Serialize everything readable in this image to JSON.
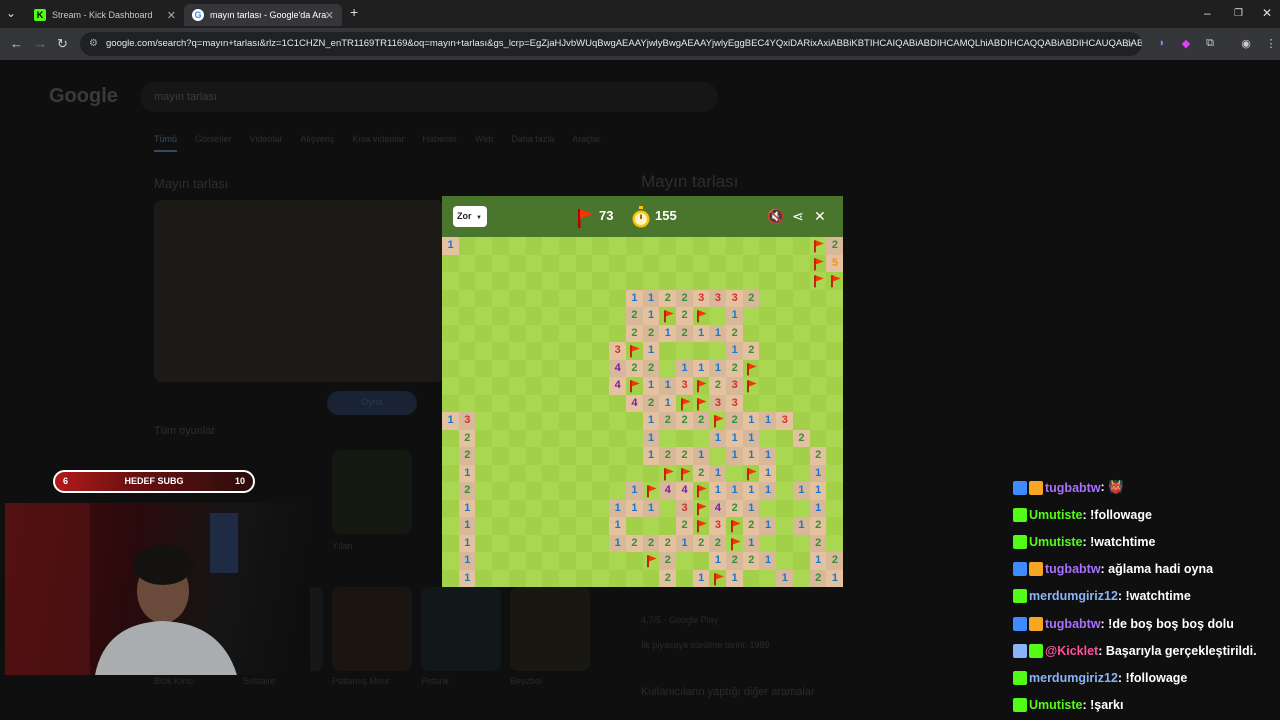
{
  "browser": {
    "tabs": [
      {
        "label": "Stream - Kick Dashboard",
        "favicon": "K"
      },
      {
        "label": "mayın tarlası - Google'da Ara",
        "favicon": "G"
      }
    ],
    "url": "google.com/search?q=mayın+tarlası&rlz=1C1CHZN_enTR1169TR1169&oq=mayın+tarlası&gs_lcrp=EgZjaHJvbWUqBwgAEAAYjwlyBwgAEAAYjwlyEggBEC4YQxiDARixAxiABBiKBTIHCAIQABiABDIHCAMQLhiABDIHCAQQABiABDIHCAUQABiABDIH..."
  },
  "google": {
    "logo": "Google",
    "query": "mayın tarlası",
    "tabs": [
      "Tümü",
      "Görseller",
      "Videolar",
      "Alışveriş",
      "Kısa videolar",
      "Haberler",
      "Web",
      "Daha fazla",
      "Araçlar"
    ],
    "left_title": "Mayın tarlası",
    "play_button": "Oyna",
    "all_games": "Tüm oyunlar",
    "games": [
      {
        "name": "Blok Kırıcı",
        "sub": "Klasik"
      },
      {
        "name": "Solitaire",
        "sub": "Kart"
      },
      {
        "name": "Patlamış Mısır",
        "sub": "Çok oyunculu"
      },
      {
        "name": "Petank",
        "sub": "Spor"
      },
      {
        "name": "Beyzbol",
        "sub": "Spor"
      },
      {
        "name": "Yılan",
        "sub": "Klasik"
      }
    ],
    "right_title": "Mayın tarlası",
    "rating": "4,7/5 · Google Play",
    "release": "İlk piyasaya sürülme tarihi: 1989",
    "related": "Kullanıcıların yaptığı diğer aramalar"
  },
  "game": {
    "difficulty": "Zor",
    "flags": "73",
    "timer": "155",
    "colors": {
      "header": "#4a752c",
      "light_grass": "#aad751",
      "dark_grass": "#a2d149",
      "dug_light": "#e5c29f",
      "dug_dark": "#d7b899"
    }
  },
  "overlay": {
    "goal_left": "6",
    "goal_label": "HEDEF SUBG",
    "goal_right": "10"
  },
  "chat": [
    {
      "user": "tugbabtw",
      "color": "#a970ff",
      "text": ": 👹",
      "badges": [
        "#3d8bff",
        "#f5a623"
      ]
    },
    {
      "user": "Umutiste",
      "color": "#53fc18",
      "text": ": !followage",
      "badges": [
        "#53fc18"
      ]
    },
    {
      "user": "Umutiste",
      "color": "#53fc18",
      "text": ": !watchtime",
      "badges": [
        "#53fc18"
      ]
    },
    {
      "user": "tugbabtw",
      "color": "#a970ff",
      "text": ": ağlama hadi oyna",
      "badges": [
        "#3d8bff",
        "#f5a623"
      ]
    },
    {
      "user": "merdumgiriz12",
      "color": "#8ab4f8",
      "text": ": !watchtime",
      "badges": [
        "#53fc18"
      ]
    },
    {
      "user": "tugbabtw",
      "color": "#a970ff",
      "text": ": !de boş boş boş dolu",
      "badges": [
        "#3d8bff",
        "#f5a623"
      ]
    },
    {
      "user": "@Kicklet",
      "color": "#ff4f9a",
      "text": ": Başarıyla gerçekleştirildi.",
      "badges": [
        "#8ab4f8",
        "#53fc18"
      ]
    },
    {
      "user": "merdumgiriz12",
      "color": "#8ab4f8",
      "text": ": !followage",
      "badges": [
        "#53fc18"
      ]
    },
    {
      "user": "Umutiste",
      "color": "#53fc18",
      "text": ": !şarkı",
      "badges": [
        "#53fc18"
      ]
    }
  ]
}
